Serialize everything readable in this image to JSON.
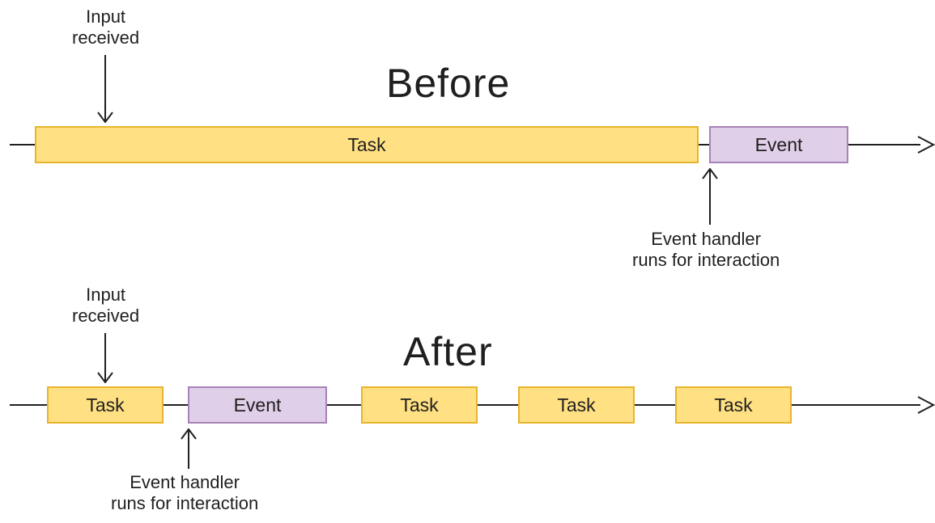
{
  "titles": {
    "before": "Before",
    "after": "After"
  },
  "labels": {
    "input_before": "Input\nreceived",
    "input_after": "Input\nreceived",
    "handler_before": "Event handler\nruns for interaction",
    "handler_after": "Event handler\nruns for interaction"
  },
  "blocks": {
    "before": {
      "task": "Task",
      "event": "Event"
    },
    "after": {
      "tasks": [
        "Task",
        "Task",
        "Task",
        "Task"
      ],
      "event": "Event"
    }
  },
  "colors": {
    "task_fill": "#ffe082",
    "task_border": "#e8b42d",
    "event_fill": "#e0cfe8",
    "event_border": "#a782b8",
    "line": "#202020"
  }
}
